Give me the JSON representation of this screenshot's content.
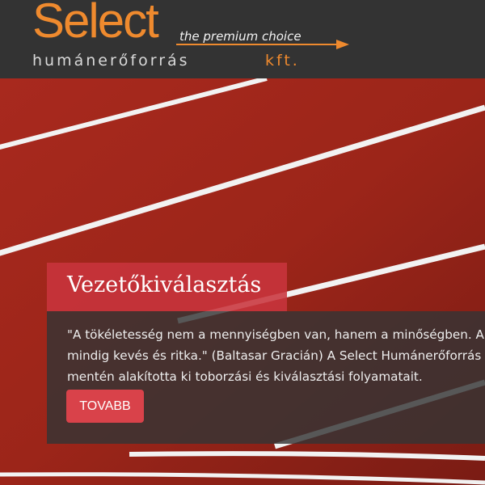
{
  "header": {
    "logo": {
      "wordmark": "Select",
      "tagline": "the premium choice",
      "subtitle": "humánerőforrás",
      "suffix": "kft."
    }
  },
  "hero": {
    "background": "running-track-image",
    "title": "Vezetőkiválasztás",
    "description_lines": [
      "\"A tökéletesség nem a mennyiségben van, hanem a minőségben. A",
      "mindig kevés és ritka.\" (Baltasar Gracián) A Select Humánerőforrás",
      "mentén alakította ki toborzási és kiválasztási folyamatait."
    ],
    "button_label": "TOVABB"
  },
  "colors": {
    "header_bg": "#333333",
    "brand_orange": "#ef8a2e",
    "track_red": "#a4271c",
    "title_box": "#c8343c",
    "button": "#d9424a"
  }
}
